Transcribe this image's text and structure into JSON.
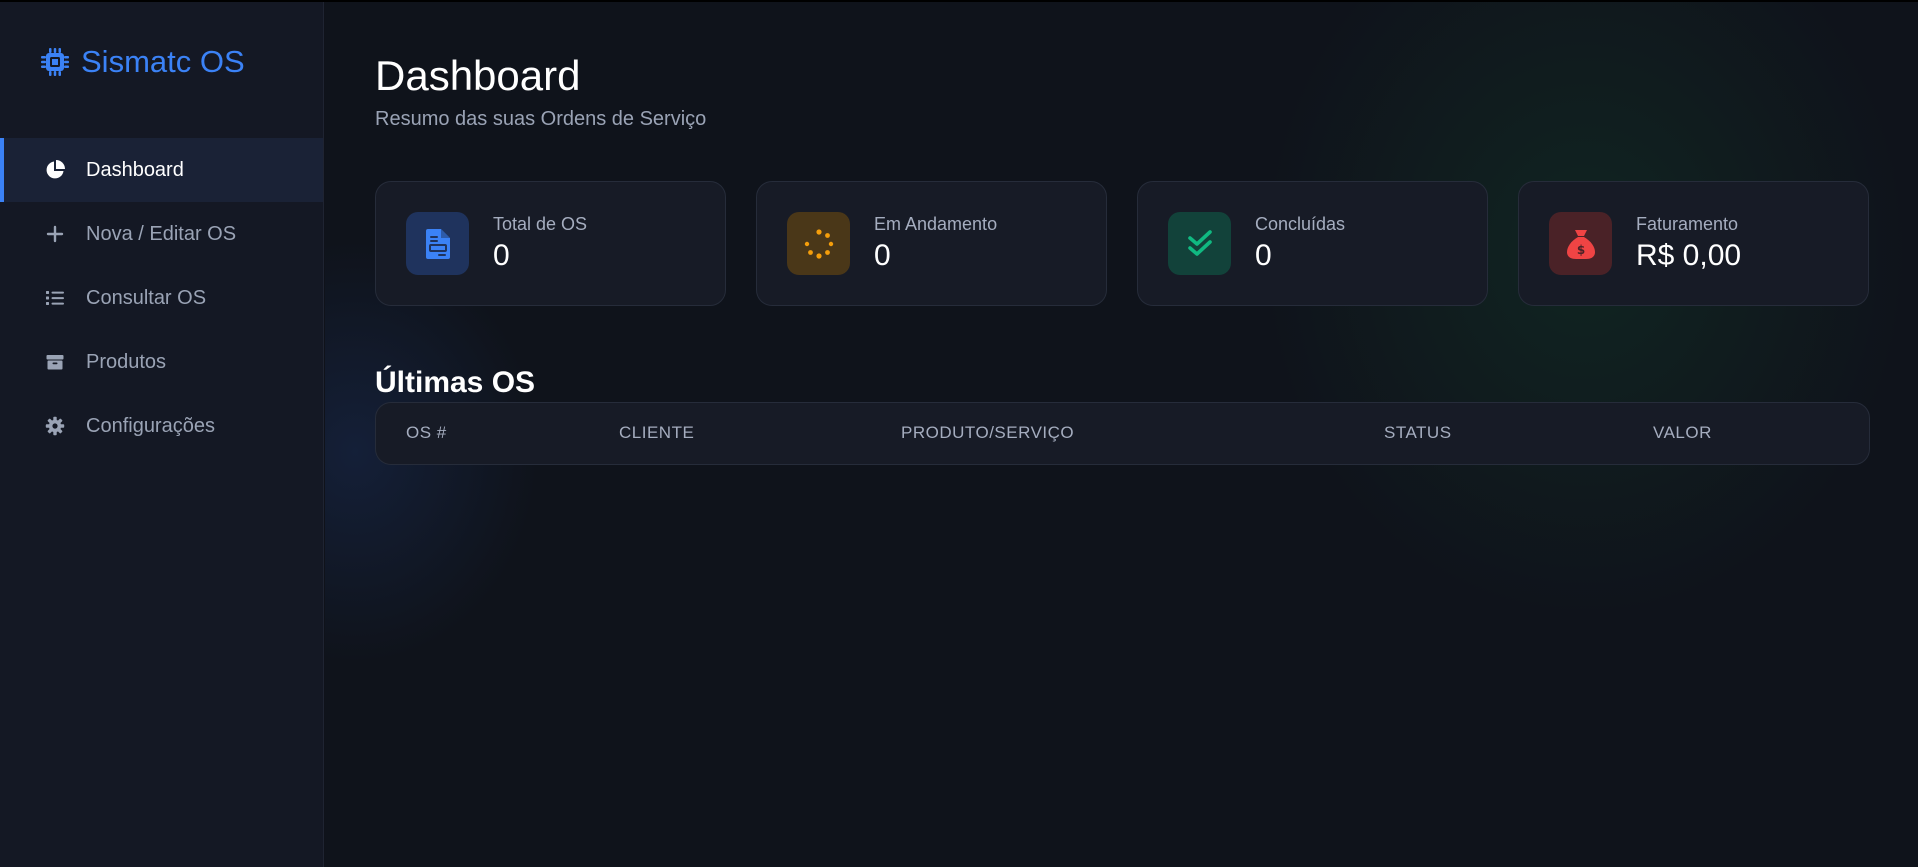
{
  "app": {
    "title": "Sismatc OS",
    "logo_icon": "cpu-chip-icon",
    "accent_color": "#3b82f6"
  },
  "sidebar": {
    "items": [
      {
        "label": "Dashboard",
        "icon": "pie-chart-icon",
        "active": true
      },
      {
        "label": "Nova / Editar OS",
        "icon": "plus-icon",
        "active": false
      },
      {
        "label": "Consultar OS",
        "icon": "list-icon",
        "active": false
      },
      {
        "label": "Produtos",
        "icon": "box-icon",
        "active": false
      },
      {
        "label": "Configurações",
        "icon": "gear-icon",
        "active": false
      }
    ]
  },
  "header": {
    "title": "Dashboard",
    "subtitle": "Resumo das suas Ordens de Serviço"
  },
  "stats": [
    {
      "label": "Total de OS",
      "value": "0",
      "icon": "document-icon",
      "color": "#3b82f6"
    },
    {
      "label": "Em Andamento",
      "value": "0",
      "icon": "spinner-icon",
      "color": "#f59e0b"
    },
    {
      "label": "Concluídas",
      "value": "0",
      "icon": "double-check-icon",
      "color": "#10b981"
    },
    {
      "label": "Faturamento",
      "value": "R$ 0,00",
      "icon": "money-bag-icon",
      "color": "#ef4444"
    }
  ],
  "recent": {
    "title": "Últimas OS",
    "columns": [
      "OS #",
      "CLIENTE",
      "PRODUTO/SERVIÇO",
      "STATUS",
      "VALOR"
    ],
    "rows": []
  }
}
